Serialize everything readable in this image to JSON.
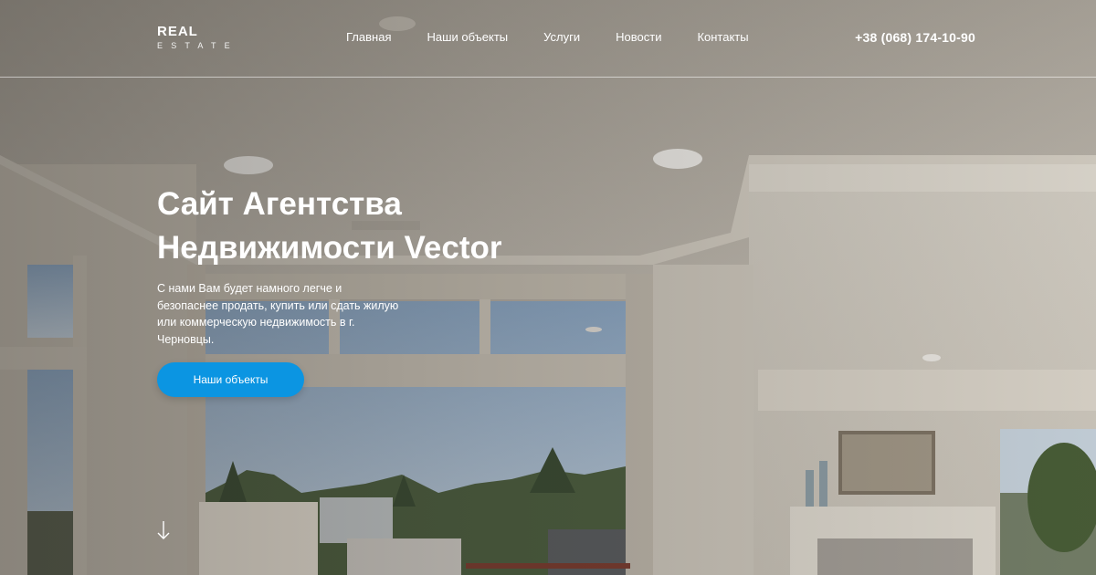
{
  "brand": {
    "name": "REAL",
    "tagline": "ESTATE"
  },
  "nav": {
    "items": [
      "Главная",
      "Наши объекты",
      "Услуги",
      "Новости",
      "Контакты"
    ]
  },
  "contact": {
    "phone": "+38 (068) 174-10-90"
  },
  "hero": {
    "title": "Сайт Агентства Недвижимости Vector",
    "description": "С нами Вам будет намного легче и безопаснее продать, купить или сдать жилую или коммерческую недвижимость в г. Черновцы.",
    "cta_label": "Наши объекты",
    "scroll_icon": "arrow-down-icon"
  },
  "colors": {
    "accent": "#0b95e2",
    "text": "#ffffff"
  }
}
